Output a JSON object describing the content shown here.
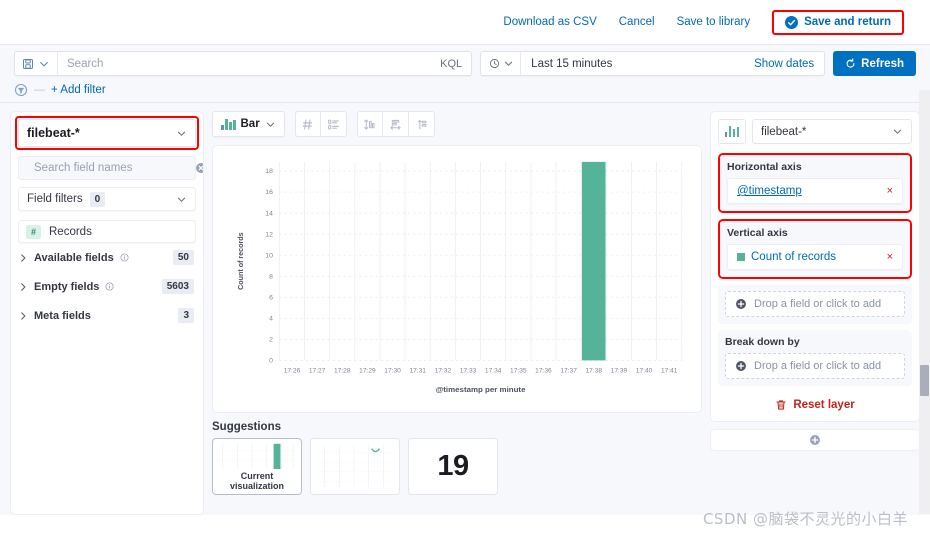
{
  "topbar": {
    "download_csv": "Download as CSV",
    "cancel": "Cancel",
    "save_to_library": "Save to library",
    "save_and_return": "Save and return"
  },
  "query_bar": {
    "search_placeholder": "Search",
    "search_value": "",
    "kql_label": "KQL",
    "date_range": "Last 15 minutes",
    "show_dates": "Show dates",
    "refresh_label": "Refresh",
    "add_filter": "+ Add filter"
  },
  "left_panel": {
    "data_view": "filebeat-*",
    "field_search_placeholder": "Search field names",
    "field_search_value": "",
    "field_filters_label": "Field filters",
    "field_filters_count": "0",
    "records_label": "Records",
    "records_type_glyph": "#",
    "groups": [
      {
        "label": "Available fields",
        "count": "50",
        "has_info": true
      },
      {
        "label": "Empty fields",
        "count": "5603",
        "has_info": true
      },
      {
        "label": "Meta fields",
        "count": "3",
        "has_info": false
      }
    ]
  },
  "chart_toolbar": {
    "vis_type": "Bar",
    "icon_buttons": [
      "hash-icon",
      "list-ordered-icon",
      "axis-vertical-icon",
      "axis-horizontal-icon",
      "legend-icon"
    ]
  },
  "suggestions": {
    "title": "Suggestions",
    "cards": [
      {
        "kind": "bar",
        "label": "Current visualization",
        "selected": true
      },
      {
        "kind": "line",
        "label": "",
        "selected": false
      },
      {
        "kind": "metric",
        "value": "19",
        "label": "",
        "selected": false
      }
    ]
  },
  "right_panel": {
    "index_pattern": "filebeat-*",
    "horizontal_axis": {
      "title": "Horizontal axis",
      "field": "@timestamp",
      "remove_label": "×",
      "highlighted": true
    },
    "vertical_axis": {
      "title": "Vertical axis",
      "field": "Count of records",
      "remove_label": "×",
      "highlighted": true,
      "color": "#54B399"
    },
    "vertical_dropzone": "Drop a field or click to add",
    "break_down_by": {
      "title": "Break down by",
      "dropzone": "Drop a field or click to add"
    },
    "reset_layer": "Reset layer"
  },
  "watermark": "CSDN @脑袋不灵光的小白羊",
  "colors": {
    "accent_blue": "#0071c2",
    "link_blue": "#006BB4",
    "bar_green": "#54B399",
    "danger_red": "#BD271E",
    "highlight_red": "#ff0000"
  },
  "chart_data": {
    "type": "bar",
    "title": "",
    "xlabel": "@timestamp per minute",
    "ylabel": "Count of records",
    "ylim": [
      0,
      19
    ],
    "yticks": [
      0,
      2,
      4,
      6,
      8,
      10,
      12,
      14,
      16,
      18
    ],
    "grid": true,
    "legend": "none",
    "categories": [
      "17:26",
      "17:27",
      "17:28",
      "17:29",
      "17:30",
      "17:31",
      "17:32",
      "17:33",
      "17:34",
      "17:35",
      "17:36",
      "17:37",
      "17:38",
      "17:39",
      "17:40",
      "17:41"
    ],
    "series": [
      {
        "name": "Count of records",
        "color": "#54B399",
        "values": [
          0,
          0,
          0,
          0,
          0,
          0,
          0,
          0,
          0,
          0,
          0,
          0,
          19,
          0,
          0,
          0
        ]
      }
    ]
  }
}
